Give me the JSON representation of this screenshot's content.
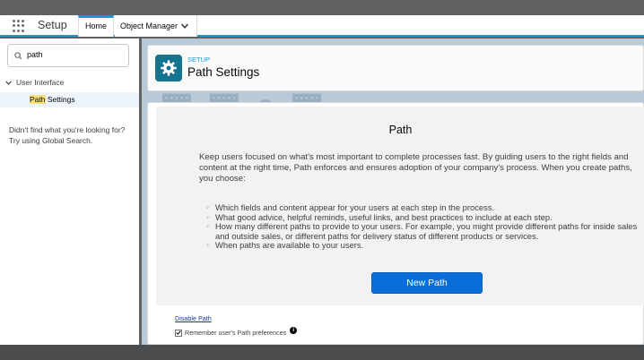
{
  "nav": {
    "app_name": "Setup",
    "tabs": [
      {
        "label": "Home"
      },
      {
        "label": "Object Manager"
      }
    ],
    "accent_color": "#1b96d3"
  },
  "sidebar": {
    "search_value": "path",
    "tree": {
      "parent": "User Interface",
      "child_match": "Path",
      "child_rest": " Settings"
    },
    "help_line1": "Didn't find what you're looking for?",
    "help_line2": "Try using Global Search."
  },
  "header": {
    "eyebrow": "SETUP",
    "title": "Path Settings",
    "icon": "gear-icon",
    "icon_color": "#16738f"
  },
  "content": {
    "heading": "Path",
    "intro": "Keep users focused on what's most important to complete processes fast. By guiding users to the right fields and content at the right time, Path enforces and ensures adoption of your company's process. When you create paths, you choose:",
    "bullets": [
      "Which fields and content appear for your users at each step in the process.",
      "What good advice, helpful reminds, useful links, and best practices to include at each step.",
      "How many different paths to provide to your users. For example, you might provide different paths for inside sales and outside sales, or different paths for delivery status of different products or services.",
      "When paths are available to your users."
    ],
    "button_label": "New Path",
    "button_color": "#0a6ed8"
  },
  "footer": {
    "disable_link": "Disable Path",
    "remember_label": "Remember user's Path preferences",
    "remember_checked": true
  }
}
